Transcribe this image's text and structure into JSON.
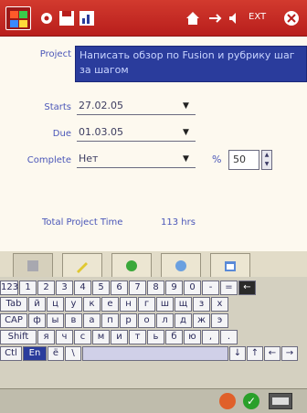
{
  "taskbar": {
    "status_text": "EXT"
  },
  "form": {
    "project_label": "Project",
    "project_value": "Написать обзор по Fusion и рубрику шаг за шагом",
    "starts_label": "Starts",
    "starts_value": "27.02.05",
    "due_label": "Due",
    "due_value": "01.03.05",
    "complete_label": "Complete",
    "complete_value": "Нет",
    "percent_symbol": "%",
    "percent_value": "50",
    "total_time_label": "Total Project Time",
    "total_time_value": "113 hrs"
  },
  "keyboard": {
    "row1": [
      "123",
      "1",
      "2",
      "3",
      "4",
      "5",
      "6",
      "7",
      "8",
      "9",
      "0",
      "-",
      "="
    ],
    "row2": [
      "Tab",
      "й",
      "ц",
      "у",
      "к",
      "е",
      "н",
      "г",
      "ш",
      "щ",
      "з",
      "х"
    ],
    "row3": [
      "CAP",
      "ф",
      "ы",
      "в",
      "а",
      "п",
      "р",
      "о",
      "л",
      "д",
      "ж",
      "э"
    ],
    "row4": [
      "Shift",
      "я",
      "ч",
      "с",
      "м",
      "и",
      "т",
      "ь",
      "б",
      "ю",
      ",",
      "."
    ],
    "row5_ctl": "Ctl",
    "row5_en": "En",
    "row5_e": "ё",
    "row5_bs": "\\",
    "row5_arrows": [
      "↓",
      "↑",
      "←",
      "→"
    ]
  },
  "colors": {
    "titlebar": "#c62a24",
    "accent_blue": "#2a3c9c",
    "label_blue": "#4a56b8"
  }
}
